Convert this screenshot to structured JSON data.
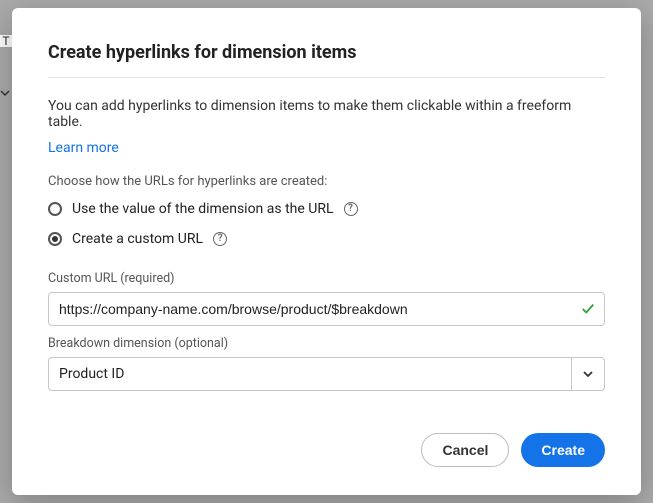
{
  "title": "Create hyperlinks for dimension items",
  "intro": "You can add hyperlinks to dimension items to make them clickable within a freeform table.",
  "learn_more": "Learn more",
  "choose_label": "Choose how the URLs for hyperlinks are created:",
  "radio": {
    "use_value": "Use the value of the dimension as the URL",
    "custom": "Create a custom URL"
  },
  "custom_url": {
    "label": "Custom URL (required)",
    "value": "https://company-name.com/browse/product/$breakdown"
  },
  "breakdown": {
    "label": "Breakdown dimension (optional)",
    "value": "Product ID"
  },
  "buttons": {
    "cancel": "Cancel",
    "create": "Create"
  },
  "bg": {
    "t": "T"
  }
}
